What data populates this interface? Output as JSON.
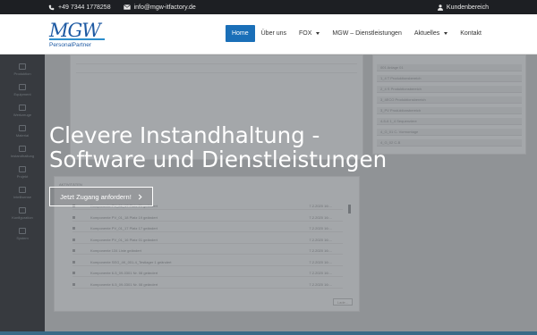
{
  "topbar": {
    "phone": "+49 7344 1778258",
    "email": "info@mgw-itfactory.de",
    "login": "Kundenbereich",
    "icons": [
      "phone-icon",
      "mail-icon",
      "user-icon"
    ]
  },
  "logo": {
    "mark": "MGW",
    "sub": "PersonalPartner"
  },
  "nav": {
    "items": [
      {
        "label": "Home",
        "active": true
      },
      {
        "label": "Über uns"
      },
      {
        "label": "FOX",
        "dropdown": true
      },
      {
        "label": "MGW – Dienstleistungen"
      },
      {
        "label": "Aktuelles",
        "dropdown": true
      },
      {
        "label": "Kontakt"
      }
    ]
  },
  "hero": {
    "title_line1": "Clevere Instandhaltung -",
    "title_line2": "Software und Dienstleistungen",
    "cta_label": "Jetzt Zugang anfordern!"
  },
  "background_app": {
    "sidebar": [
      "Produktion",
      "Equipment",
      "Werkzeuge",
      "Material",
      "Instandhaltung",
      "Projekt",
      "Intellisense",
      "Konfiguration",
      "System"
    ],
    "right_list": [
      "001 Anlage 01",
      "1_4 T Produktionsbereich",
      "2_4 S Produktionsbereich",
      "3_4ECO Produktionsbereich",
      "3_PV Produktionsbereich",
      "4-5-6 1_4 Sequenziere",
      "4_G_01 C- Vormontage",
      "4_G_02 C-B"
    ],
    "activities_title": "AKTIVITÄTEN",
    "activities": [
      {
        "text": "Komponente PV_01_17 Platz 21 geändert",
        "date": "7.2.2020 16:..."
      },
      {
        "text": "Komponente PV_01_18 Platz 19 geändert",
        "date": "7.2.2020 16:..."
      },
      {
        "text": "Komponente PV_01_17 Platz 17 geändert",
        "date": "7.2.2020 16:..."
      },
      {
        "text": "Komponente PV_01_16 Platz 01 geändert",
        "date": "7.2.2020 16:..."
      },
      {
        "text": "Komponente 134 Linie geändert",
        "date": "7.2.2020 16:..."
      },
      {
        "text": "Komponente SEG_4K_001-4_Testlager 1 geändert",
        "date": "7.2.2020 16:..."
      },
      {
        "text": "Komponente 6-5_09-0301 Nr. 08 geändert",
        "date": "7.2.2020 16:..."
      },
      {
        "text": "Komponente 6-5_09-0301 Nr. 08 geändert",
        "date": "7.2.2020 16:..."
      }
    ],
    "more_button": "Lade..."
  },
  "colors": {
    "nav_active": "#1a6fb8",
    "topbar": "#1d1f23",
    "brand": "#1e5aa3"
  }
}
